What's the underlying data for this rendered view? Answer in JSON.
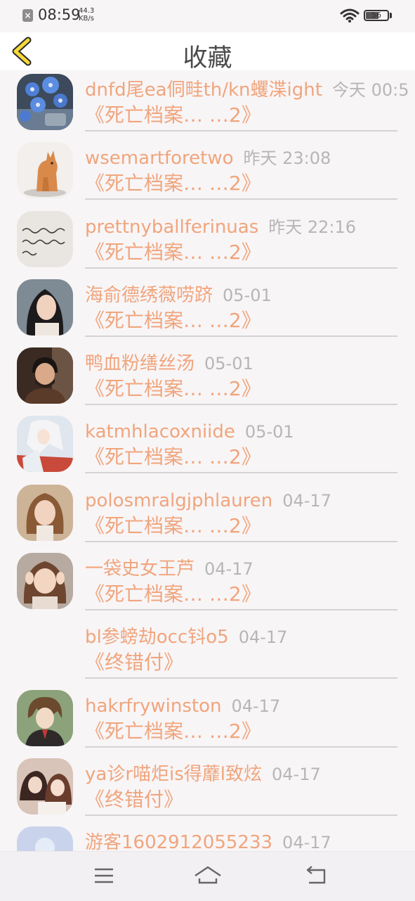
{
  "status_bar": {
    "time": "08:59",
    "speed_value": "44.3",
    "speed_unit": "KB/s",
    "battery": "56"
  },
  "header": {
    "title": "收藏"
  },
  "items": [
    {
      "name": "dnfd尾ea侗畦th/kn蠼渫ight",
      "time": "今天 00:5",
      "book": "《死亡档案… …2》",
      "avatar": "blue-flowers"
    },
    {
      "name": "wsemartforetwo",
      "time": "昨天 23:08",
      "book": "《死亡档案… …2》",
      "avatar": "dog-figurine"
    },
    {
      "name": "prettnyballferinuas",
      "time": "昨天 22:16",
      "book": "《死亡档案… …2》",
      "avatar": "handwriting-note"
    },
    {
      "name": "海俞德绣薇唠跻",
      "time": "05-01",
      "book": "《死亡档案… …2》",
      "avatar": "woman-portrait"
    },
    {
      "name": "鸭血粉缮丝汤",
      "time": "05-01",
      "book": "《死亡档案… …2》",
      "avatar": "man-portrait"
    },
    {
      "name": "katmhlacoxniide",
      "time": "05-01",
      "book": "《死亡档案… …2》",
      "avatar": "anime-girl"
    },
    {
      "name": "polosmralgjphlauren",
      "time": "04-17",
      "book": "《死亡档案… …2》",
      "avatar": "girl-portrait"
    },
    {
      "name": "一袋史女王芦",
      "time": "04-17",
      "book": "《死亡档案… …2》",
      "avatar": "child-portrait"
    },
    {
      "name": "bl参螃劫occ钭o5",
      "time": "04-17",
      "book": "《终错付》",
      "avatar": "none"
    },
    {
      "name": "hakrfrywinston",
      "time": "04-17",
      "book": "《死亡档案… …2》",
      "avatar": "anime-boy"
    },
    {
      "name": "ya诊r喵炬is得蘼l致炫",
      "time": "04-17",
      "book": "《终错付》",
      "avatar": "couple-photo"
    },
    {
      "name": "游客1602912055233",
      "time": "04-17",
      "book": "",
      "avatar": "default-avatar"
    }
  ],
  "nav": {
    "menu": "menu-icon",
    "home": "home-icon",
    "back": "back-icon"
  },
  "colors": {
    "accent": "#f0a57c",
    "time": "#b6b6b6",
    "back_arrow": "#f5d83a",
    "background": "#f8f5f7"
  }
}
